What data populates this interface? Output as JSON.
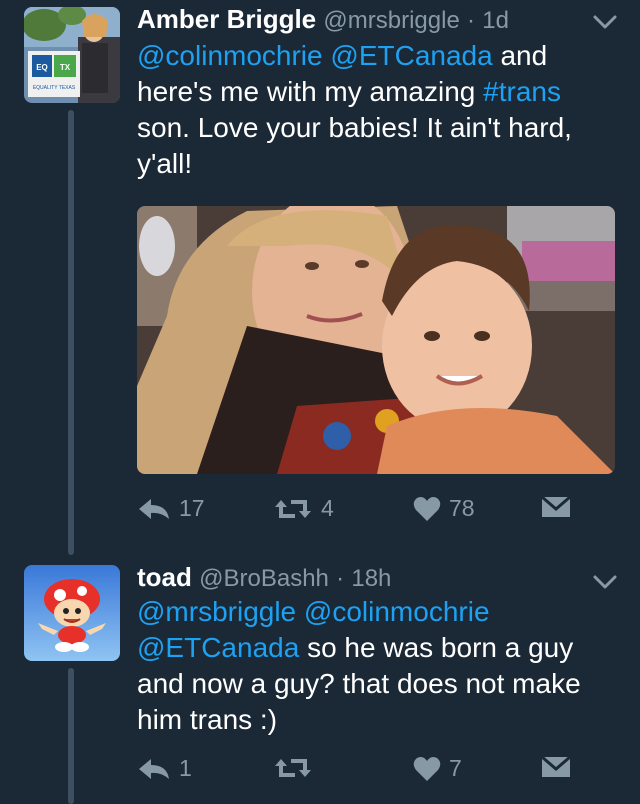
{
  "tweets": [
    {
      "name": "Amber Briggle",
      "handle": "@mrsbriggle",
      "sep": "·",
      "time": "1d",
      "mention1": "@colinmochrie",
      "mention2": "@ETCanada",
      "text1": " and here's me with my amazing ",
      "hashtag": "#trans",
      "text2": " son. Love your babies!  It ain't hard, y'all!",
      "avatar_sign": {
        "eq": "EQ",
        "tx": "TX",
        "caption": "EQUALITY TEXAS"
      },
      "replies": "17",
      "retweets": "4",
      "likes": "78"
    },
    {
      "name": "toad",
      "handle": "@BroBashh",
      "sep": "·",
      "time": "18h",
      "mention1": "@mrsbriggle",
      "mention2": "@colinmochrie",
      "mention3": "@ETCanada",
      "text1": " so he was born a guy and now a guy? that does not make him trans :)",
      "replies": "1",
      "retweets": "",
      "likes": "7"
    }
  ],
  "colors": {
    "background": "#1b2836",
    "link": "#1da1f2",
    "muted": "#8899a6",
    "thread_line": "#3d4f61"
  },
  "icons": [
    "reply-icon",
    "retweet-icon",
    "like-icon",
    "message-icon",
    "chevron-down-icon"
  ]
}
